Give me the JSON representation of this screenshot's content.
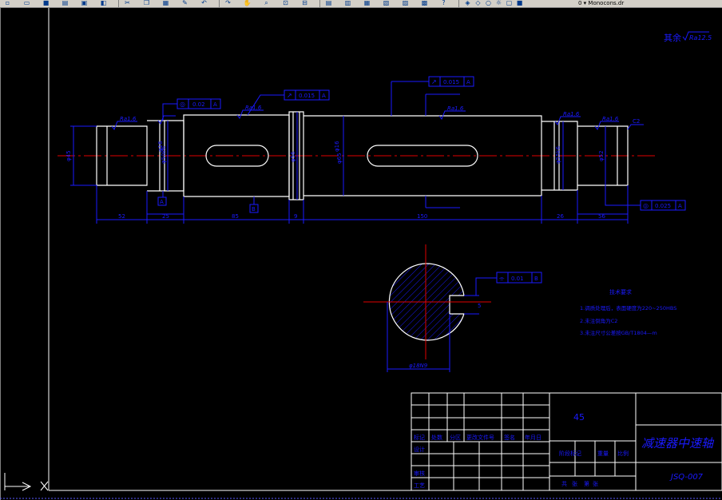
{
  "toolbar": {
    "icons": [
      "new-icon",
      "open-icon",
      "save-icon",
      "print-icon",
      "preview-icon",
      "publish-icon",
      "cut-icon",
      "copy-icon",
      "paste-icon",
      "match-properties-icon",
      "undo-icon",
      "redo-icon",
      "pan-icon",
      "zoom-realtime-icon",
      "zoom-window-icon",
      "zoom-previous-icon",
      "properties-icon",
      "design-center-icon",
      "tool-palettes-icon",
      "sheet-set-icon",
      "markup-icon",
      "calculator-icon",
      "help-icon",
      "layer-icon",
      "layer-state-icon",
      "bulb-icon",
      "sun-icon",
      "lock-icon",
      "color-icon"
    ],
    "layer_text": "0 ▾ Monocons.dr"
  },
  "drawing": {
    "roughness_other": "其余",
    "roughness_other_value": "Ra12.5",
    "roughness_values": [
      "Ra1.6",
      "Ra1.6",
      "Ra1.6",
      "Ra1.6",
      "Ra1.6",
      "Ra1.6"
    ],
    "tolerance_frames": [
      {
        "symbol": "◎",
        "value": "0.02",
        "datum": "A"
      },
      {
        "symbol": "↗",
        "value": "0.015",
        "datum": "A"
      },
      {
        "symbol": "↗",
        "value": "0.015",
        "datum": "A"
      },
      {
        "symbol": "◎",
        "value": "0.025",
        "datum": "A"
      },
      {
        "symbol": "⌯",
        "value": "0.01",
        "datum": "B"
      }
    ],
    "datum_labels": [
      "A",
      "B"
    ],
    "chamfer": "C2",
    "diameter_labels": [
      "φ45",
      "φ50k6",
      "φ56",
      "φ65",
      "φ55k6",
      "φ52",
      "φ45"
    ],
    "width_labels": [
      "φ16",
      "φ16"
    ],
    "length_dims": [
      "52",
      "25",
      "85",
      "9",
      "150",
      "26",
      "56"
    ],
    "section_key_depth": "5",
    "section_diameter": "φ18N9",
    "tech_req": {
      "title": "技术要求",
      "lines": [
        "1.调质处理后，表面硬度为220~250HBS",
        "2.未注倒角为C2",
        "3.未注尺寸公差按GB/T1804—m"
      ]
    },
    "title_block": {
      "material": "45",
      "part_name": "减速器中速轴",
      "drawing_no": "JSQ-007",
      "header_cells": [
        "标记",
        "处数",
        "分区",
        "更改文件号",
        "签名",
        "年月日"
      ],
      "left_labels": [
        "设计",
        "审核",
        "工艺"
      ],
      "stage_label": "阶段标记",
      "weight_label": "重量",
      "ratio_label": "比例",
      "sheet_labels": [
        "共",
        "张",
        "第",
        "张"
      ]
    }
  },
  "colors": {
    "frame": "#ffffff",
    "geometry": "#ffffff",
    "dimension": "#1a1aff",
    "centerline": "#e10000",
    "hatch": "#1a1aff",
    "annotation": "#1a1aff"
  }
}
